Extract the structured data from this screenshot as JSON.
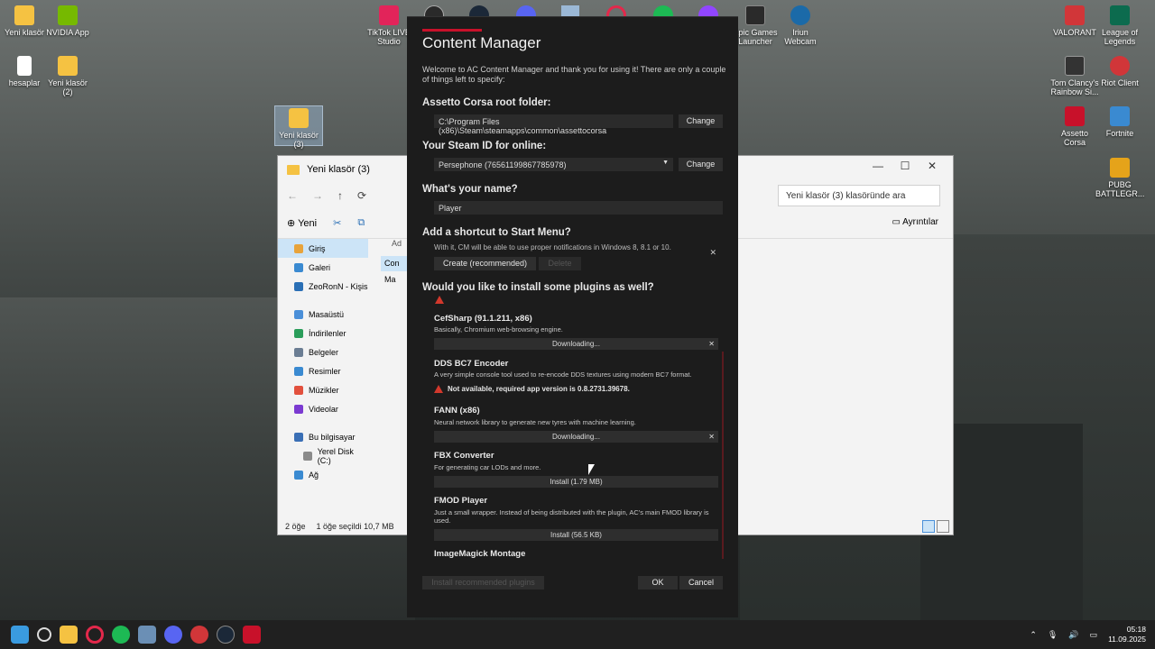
{
  "desktop": {
    "icons": [
      {
        "label": "Yeni klasör",
        "color": "#f5c242"
      },
      {
        "label": "NVIDIA App",
        "color": "#76b900"
      },
      {
        "label": "hesaplar",
        "color": "#ffffff"
      },
      {
        "label": "Yeni klasör (2)",
        "color": "#f5c242"
      },
      {
        "label": "Yeni klasör (3)",
        "color": "#f5c242"
      },
      {
        "label": "TikTok LIVE Studio",
        "color": "#e2245a"
      },
      {
        "label": "Epic Games Launcher",
        "color": "#2a2a2a"
      },
      {
        "label": "Iriun Webcam",
        "color": "#1b6aa8"
      },
      {
        "label": "VALORANT",
        "color": "#d13639"
      },
      {
        "label": "League of Legends",
        "color": "#0c6b4e"
      },
      {
        "label": "Tom Clancy's Rainbow Si...",
        "color": "#333333"
      },
      {
        "label": "Riot Client",
        "color": "#d13639"
      },
      {
        "label": "Assetto Corsa",
        "color": "#c8112a"
      },
      {
        "label": "Fortnite",
        "color": "#3a8ad1"
      },
      {
        "label": "PUBG BATTLEGR...",
        "color": "#e5a31a"
      }
    ]
  },
  "explorer": {
    "title": "Yeni klasör (3)",
    "window_controls": [
      "—",
      "☐",
      "✕"
    ],
    "nav": [
      "←",
      "→",
      "↑",
      "⟳"
    ],
    "search_placeholder": "Yeni klasör (3) klasöründe ara",
    "new_label": "Yeni",
    "details_label": "Ayrıntılar",
    "column_header": "Ad",
    "file_partial_1": "Con",
    "file_partial_2": "Ma",
    "sidebar": [
      {
        "label": "Giriş",
        "active": true
      },
      {
        "label": "Galeri"
      },
      {
        "label": "ZeoRonN - Kişis"
      },
      {
        "label": "Masaüstü"
      },
      {
        "label": "İndirilenler"
      },
      {
        "label": "Belgeler"
      },
      {
        "label": "Resimler"
      },
      {
        "label": "Müzikler"
      },
      {
        "label": "Videolar"
      },
      {
        "label": "Bu bilgisayar"
      },
      {
        "label": "Yerel Disk (C:)"
      },
      {
        "label": "Ağ"
      }
    ],
    "status_items": "2 öğe",
    "status_selected": "1 öğe seçildi  10,7 MB"
  },
  "cm": {
    "title": "Content Manager",
    "intro": "Welcome to AC Content Manager and thank you for using it! There are only a couple of things left to specify:",
    "root_heading": "Assetto Corsa root folder:",
    "root_path": "C:\\Program Files (x86)\\Steam\\steamapps\\common\\assettocorsa",
    "change_label": "Change",
    "steam_heading": "Your Steam ID for online:",
    "steam_value": "Persephone (76561199867785978)",
    "name_heading": "What's your name?",
    "name_value": "Player",
    "shortcut_heading": "Add a shortcut to Start Menu?",
    "shortcut_desc": "With it, CM will be able to use proper notifications in Windows 8, 8.1 or 10.",
    "create_label": "Create (recommended)",
    "delete_label": "Delete",
    "plugins_heading": "Would you like to install some plugins as well?",
    "plugins": [
      {
        "name": "CefSharp (91.1.211, x86)",
        "desc": "Basically, Chromium web-browsing engine.",
        "action": "Downloading..."
      },
      {
        "name": "DDS BC7 Encoder",
        "desc": "A very simple console tool used to re-encode DDS textures using modern BC7 format.",
        "warning": "Not available, required app version is 0.8.2731.39678."
      },
      {
        "name": "FANN (x86)",
        "desc": "Neural network library to generate new tyres with machine learning.",
        "action": "Downloading..."
      },
      {
        "name": "FBX Converter",
        "desc": "For generating car LODs and more.",
        "action": "Install (1.79 MB)"
      },
      {
        "name": "FMOD Player",
        "desc": "Just a small wrapper. Instead of being distributed with the plugin, AC's main FMOD library is used.",
        "action": "Install (56.5 KB)"
      },
      {
        "name": "ImageMagick Montage",
        "desc": ""
      }
    ],
    "install_recommended": "Install recommended plugins",
    "ok_label": "OK",
    "cancel_label": "Cancel",
    "accent_color": "#c8112a"
  },
  "taskbar": {
    "apps": [
      "windows-start-icon",
      "search-icon",
      "file-explorer-icon",
      "opera-gx-icon",
      "spotify-icon",
      "network-icon",
      "discord-icon",
      "riot-icon",
      "steam-icon",
      "content-manager-icon"
    ],
    "time": "05:18",
    "date": "11.09.2025"
  }
}
